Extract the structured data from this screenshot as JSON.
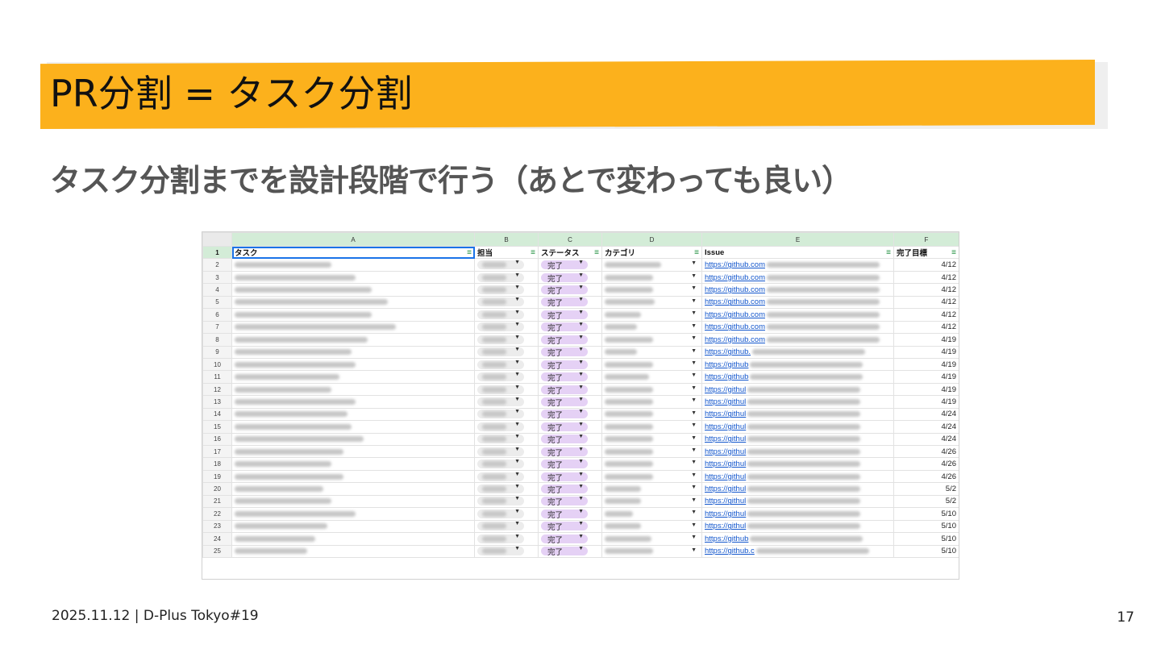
{
  "slide": {
    "title": "PR分割 = タスク分割",
    "subtitle": "タスク分割までを設計段階で行う（あとで変わっても良い）",
    "footer": "2025.11.12 | D-Plus Tokyo#19",
    "page_number": "17",
    "accent_color": "#fcb11c"
  },
  "sheet": {
    "column_letters": [
      "A",
      "B",
      "C",
      "D",
      "E",
      "F"
    ],
    "header_row_number": "1",
    "headers": [
      "タスク",
      "担当",
      "ステータス",
      "カテゴリ",
      "Issue",
      "完了目標"
    ],
    "filter_icon": "filter-icon",
    "status_chip_color": "#e5d1f5",
    "header_band_color": "#d3ecd7",
    "rows": [
      {
        "num": "2",
        "status": "完了",
        "issue": "https://github.com",
        "target": "4/12"
      },
      {
        "num": "3",
        "status": "完了",
        "issue": "https://github.com",
        "target": "4/12"
      },
      {
        "num": "4",
        "status": "完了",
        "issue": "https://github.com",
        "target": "4/12"
      },
      {
        "num": "5",
        "status": "完了",
        "issue": "https://github.com",
        "target": "4/12"
      },
      {
        "num": "6",
        "status": "完了",
        "issue": "https://github.com",
        "target": "4/12"
      },
      {
        "num": "7",
        "status": "完了",
        "issue": "https://github.com",
        "target": "4/12"
      },
      {
        "num": "8",
        "status": "完了",
        "issue": "https://github.com",
        "target": "4/19"
      },
      {
        "num": "9",
        "status": "完了",
        "issue": "https://github.",
        "target": "4/19"
      },
      {
        "num": "10",
        "status": "完了",
        "issue": "https://github",
        "target": "4/19"
      },
      {
        "num": "11",
        "status": "完了",
        "issue": "https://github",
        "target": "4/19"
      },
      {
        "num": "12",
        "status": "完了",
        "issue": "https://githul",
        "target": "4/19"
      },
      {
        "num": "13",
        "status": "完了",
        "issue": "https://githul",
        "target": "4/19"
      },
      {
        "num": "14",
        "status": "完了",
        "issue": "https://githul",
        "target": "4/24"
      },
      {
        "num": "15",
        "status": "完了",
        "issue": "https://githul",
        "target": "4/24"
      },
      {
        "num": "16",
        "status": "完了",
        "issue": "https://githul",
        "target": "4/24"
      },
      {
        "num": "17",
        "status": "完了",
        "issue": "https://githul",
        "target": "4/26"
      },
      {
        "num": "18",
        "status": "完了",
        "issue": "https://githul",
        "target": "4/26"
      },
      {
        "num": "19",
        "status": "完了",
        "issue": "https://githul",
        "target": "4/26"
      },
      {
        "num": "20",
        "status": "完了",
        "issue": "https://githul",
        "target": "5/2"
      },
      {
        "num": "21",
        "status": "完了",
        "issue": "https://githul",
        "target": "5/2"
      },
      {
        "num": "22",
        "status": "完了",
        "issue": "https://githul",
        "target": "5/10"
      },
      {
        "num": "23",
        "status": "完了",
        "issue": "https://githul",
        "target": "5/10"
      },
      {
        "num": "24",
        "status": "完了",
        "issue": "https://github",
        "target": "5/10"
      },
      {
        "num": "25",
        "status": "完了",
        "issue": "https://github.c",
        "target": "5/10"
      }
    ]
  }
}
